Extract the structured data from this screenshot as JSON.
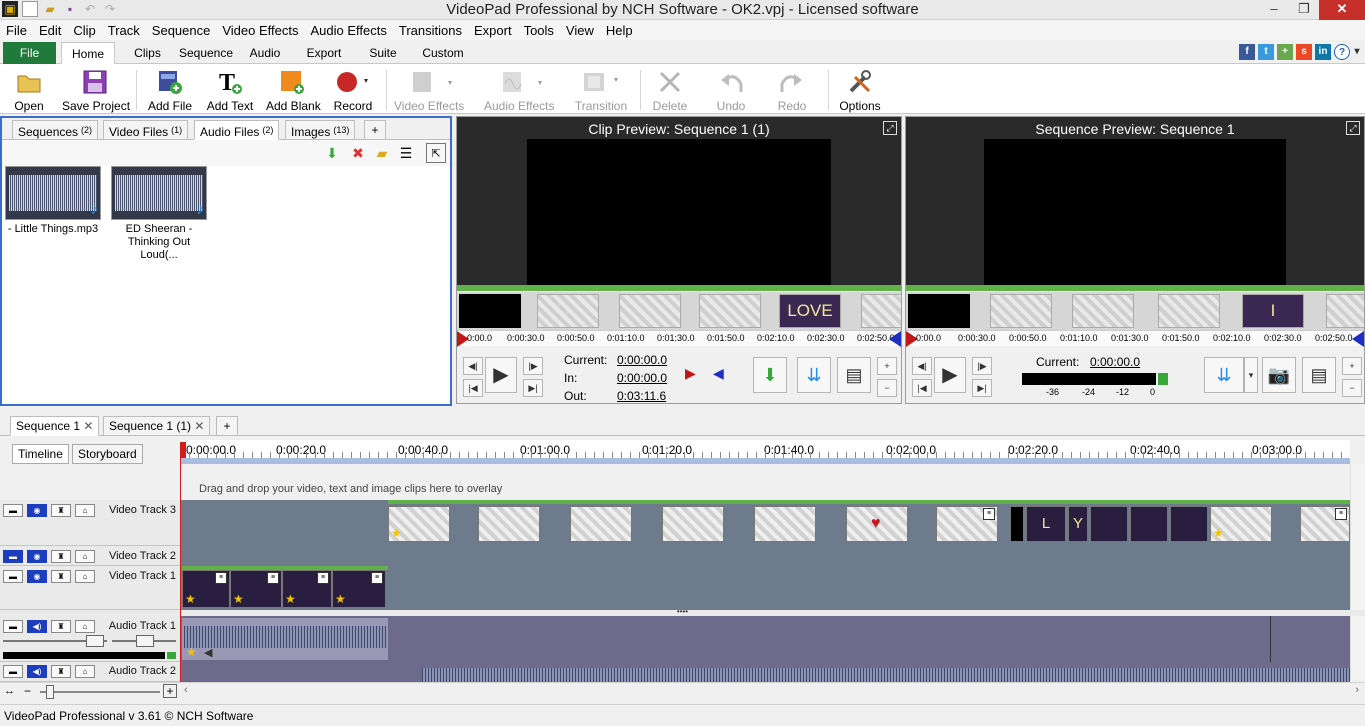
{
  "window": {
    "title": "VideoPad Professional by NCH Software - OK2.vpj - Licensed software"
  },
  "menu": [
    "File",
    "Edit",
    "Clip",
    "Track",
    "Sequence",
    "Video Effects",
    "Audio Effects",
    "Transitions",
    "Export",
    "Tools",
    "View",
    "Help"
  ],
  "ribbon_tabs": [
    "File",
    "Home",
    "Clips",
    "Sequence",
    "Audio",
    "Export",
    "Suite",
    "Custom"
  ],
  "toolbar": {
    "open": "Open",
    "save_project": "Save Project",
    "add_file": "Add File",
    "add_text": "Add Text",
    "add_blank": "Add Blank",
    "record": "Record",
    "video_effects": "Video Effects",
    "audio_effects": "Audio Effects",
    "transition": "Transition",
    "delete": "Delete",
    "undo": "Undo",
    "redo": "Redo",
    "options": "Options"
  },
  "bin": {
    "tabs": [
      {
        "label": "Sequences",
        "count": "(2)"
      },
      {
        "label": "Video Files",
        "count": "(1)"
      },
      {
        "label": "Audio Files",
        "count": "(2)"
      },
      {
        "label": "Images",
        "count": "(13)"
      }
    ],
    "add_tab": "+",
    "items": [
      {
        "caption": "- Little Things.mp3"
      },
      {
        "caption": "ED Sheeran - Thinking Out Loud(..."
      }
    ]
  },
  "clip_preview": {
    "title": "Clip Preview: Sequence 1 (1)",
    "strip_title": "LOVE",
    "ruler": [
      "0:00.0",
      "0:00:30.0",
      "0:00:50.0",
      "0:01:10.0",
      "0:01:30.0",
      "0:01:50.0",
      "0:02:10.0",
      "0:02:30.0",
      "0:02:50.0"
    ],
    "current_label": "Current:",
    "current": "0:00:00.0",
    "in_label": "In:",
    "in": "0:00:00.0",
    "out_label": "Out:",
    "out": "0:03:11.6"
  },
  "sequence_preview": {
    "title": "Sequence Preview: Sequence 1",
    "strip_title": "I",
    "ruler": [
      "0:00.0",
      "0:00:30.0",
      "0:00:50.0",
      "0:01:10.0",
      "0:01:30.0",
      "0:01:50.0",
      "0:02:10.0",
      "0:02:30.0",
      "0:02:50.0"
    ],
    "current_label": "Current:",
    "current": "0:00:00.0",
    "meter": [
      "-36",
      "-24",
      "-12",
      "0"
    ]
  },
  "sequence_tabs": [
    "Sequence 1",
    "Sequence 1 (1)"
  ],
  "timeline": {
    "tabs": [
      "Timeline",
      "Storyboard"
    ],
    "ruler": [
      "0:00:00.0",
      "0:00:20.0",
      "0:00:40.0",
      "0:01:00.0",
      "0:01:20.0",
      "0:01:40.0",
      "0:02:00.0",
      "0:02:20.0",
      "0:02:40.0",
      "0:03:00.0"
    ],
    "overlay_hint": "Drag and drop your video, text and image clips here to overlay",
    "tracks": {
      "video3": "Video Track 3",
      "video2": "Video Track 2",
      "video1": "Video Track 1",
      "audio1": "Audio Track 1",
      "audio2": "Audio Track 2"
    },
    "v3_title_letters": [
      "L",
      "Y"
    ]
  },
  "status": {
    "text": "VideoPad Professional v 3.61 © NCH Software"
  },
  "colors": {
    "file_tab": "#1f7a3c",
    "playhead": "#d21b1b",
    "track_green": "#62b148"
  }
}
